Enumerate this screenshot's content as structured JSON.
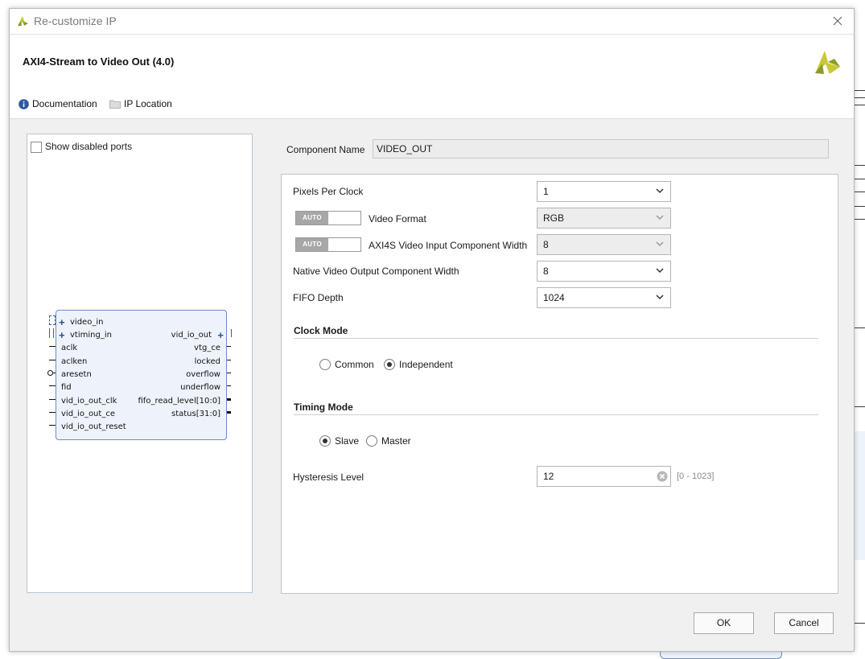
{
  "window": {
    "title": "Re-customize IP"
  },
  "header": {
    "ip_title": "AXI4-Stream to Video Out (4.0)"
  },
  "links": {
    "documentation": "Documentation",
    "ip_location": "IP Location"
  },
  "left_panel": {
    "show_disabled_ports": "Show disabled ports",
    "left_ports": [
      "video_in",
      "vtiming_in",
      "aclk",
      "aclken",
      "aresetn",
      "fid",
      "vid_io_out_clk",
      "vid_io_out_ce",
      "vid_io_out_reset"
    ],
    "right_ports": [
      "vid_io_out",
      "vtg_ce",
      "locked",
      "overflow",
      "underflow",
      "fifo_read_level[10:0]",
      "status[31:0]"
    ]
  },
  "component": {
    "label": "Component Name",
    "value": "VIDEO_OUT"
  },
  "params": {
    "pixels_per_clock": {
      "label": "Pixels Per Clock",
      "value": "1"
    },
    "video_format": {
      "label": "Video Format",
      "value": "RGB",
      "auto": "AUTO"
    },
    "axi4s_width": {
      "label": "AXI4S Video Input Component Width",
      "value": "8",
      "auto": "AUTO"
    },
    "native_width": {
      "label": "Native Video Output Component Width",
      "value": "8"
    },
    "fifo_depth": {
      "label": "FIFO Depth",
      "value": "1024"
    },
    "clock_mode": {
      "title": "Clock Mode",
      "common": "Common",
      "independent": "Independent",
      "selected": "Independent"
    },
    "timing_mode": {
      "title": "Timing Mode",
      "slave": "Slave",
      "master": "Master",
      "selected": "Slave"
    },
    "hysteresis": {
      "label": "Hysteresis Level",
      "value": "12",
      "range": "[0 - 1023]"
    }
  },
  "buttons": {
    "ok": "OK",
    "cancel": "Cancel"
  },
  "colors": {
    "logo_yellow": "#c8c838",
    "logo_green": "#8c9a2a",
    "info_blue": "#2d5aa0",
    "block_fill": "#eef3fb",
    "block_border": "#6b8cc7"
  }
}
